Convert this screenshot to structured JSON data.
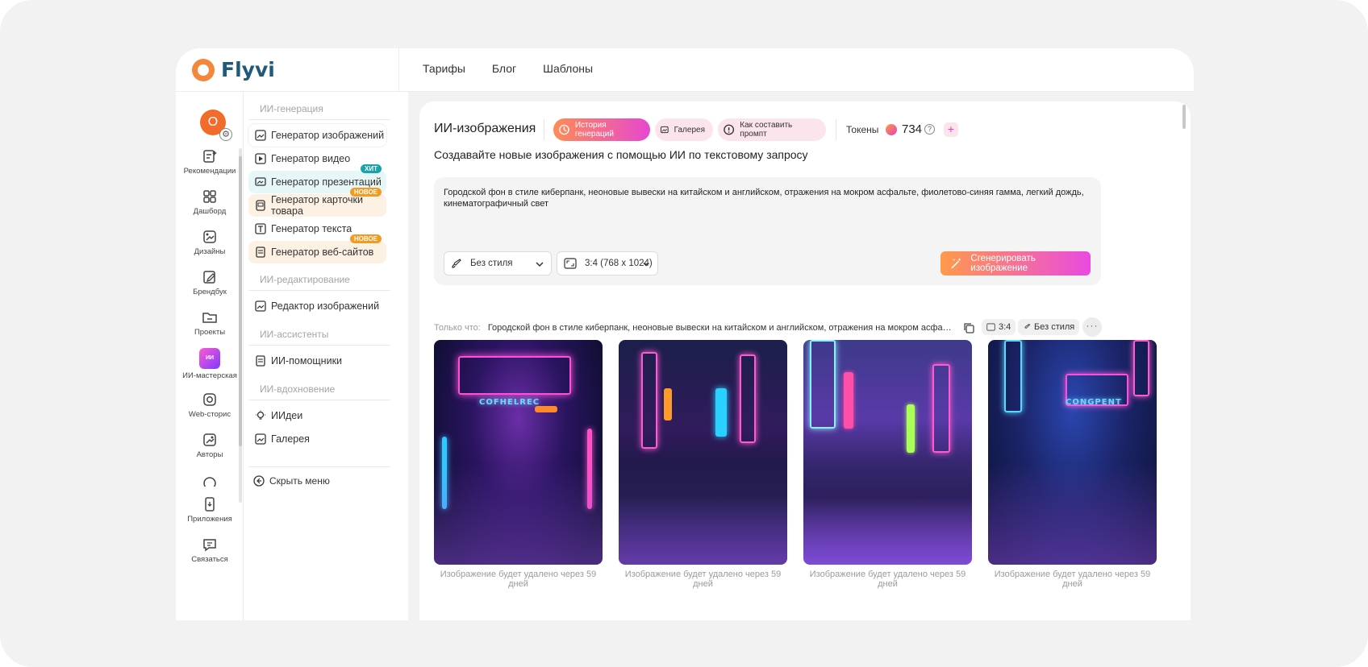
{
  "app": {
    "logo": "Flyvi",
    "topnav": [
      "Тарифы",
      "Блог",
      "Шаблоны"
    ]
  },
  "leftbar": {
    "avatar_letter": "O",
    "items": [
      {
        "label": "Рекомендации",
        "icon": "recommendations-icon"
      },
      {
        "label": "Дашборд",
        "icon": "dashboard-icon"
      },
      {
        "label": "Дизайны",
        "icon": "designs-icon"
      },
      {
        "label": "Брендбук",
        "icon": "brandbook-icon"
      },
      {
        "label": "Проекты",
        "icon": "folder-icon"
      },
      {
        "label": "ИИ-мастерская",
        "icon": "ai-workshop-icon"
      },
      {
        "label": "Web-сторис",
        "icon": "instagram-icon"
      },
      {
        "label": "Авторы",
        "icon": "authors-icon"
      },
      {
        "label": "Приложения",
        "icon": "apps-icon"
      },
      {
        "label": "Связаться",
        "icon": "chat-icon"
      }
    ],
    "mascot_text": "ИИ"
  },
  "menu": {
    "sections": {
      "generation": "ИИ-генерация",
      "editing": "ИИ-редактирование",
      "assistants": "ИИ-ассистенты",
      "inspiration": "ИИ-вдохновение"
    },
    "items": {
      "image_gen": "Генератор изображений",
      "video_gen": "Генератор видео",
      "presentation_gen": "Генератор презентаций",
      "product_card_gen": "Генератор карточки товара",
      "text_gen": "Генератор текста",
      "website_gen": "Генератор веб-сайтов",
      "image_editor": "Редактор изображений",
      "ai_helpers": "ИИ-помощники",
      "ideas": "ИИдеи",
      "gallery": "Галерея"
    },
    "badges": {
      "hit": "ХИТ",
      "new": "НОВОЕ"
    },
    "hide_menu": "Скрыть меню"
  },
  "main": {
    "title": "ИИ-изображения",
    "history_btn": "История генераций",
    "gallery_btn": "Галерея",
    "prompt_help_btn": "Как составить промпт",
    "tokens_label": "Токены",
    "tokens_value": "734",
    "subtitle": "Создавайте новые изображения с помощью ИИ по текстовому запросу",
    "prompt": "Городской фон в стиле киберпанк, неоновые вывески на китайском и английском, отражения на мокром асфальте, фиолетово-синяя гамма, легкий дождь, кинематографичный свет",
    "style_select": "Без стиля",
    "ratio_select": "3:4 (768 x 1024)",
    "generate_btn": "Сгенерировать изображение",
    "recent_label": "Только что:",
    "recent_prompt": "Городской фон в стиле киберпанк, неоновые вывески на китайском и английском, отражения на мокром асфальте, ...",
    "recent_ratio": "3:4",
    "recent_style": "Без стиля",
    "more": "···",
    "image_caption": "Изображение будет удалено через 59 дней",
    "image_texts": [
      "COFHELREC",
      "",
      "",
      "CONGPENT"
    ]
  },
  "colors": {
    "brand_orange": "#f3873a",
    "logo_blue": "#1f5a7a",
    "accent_pink": "#e648d0"
  }
}
